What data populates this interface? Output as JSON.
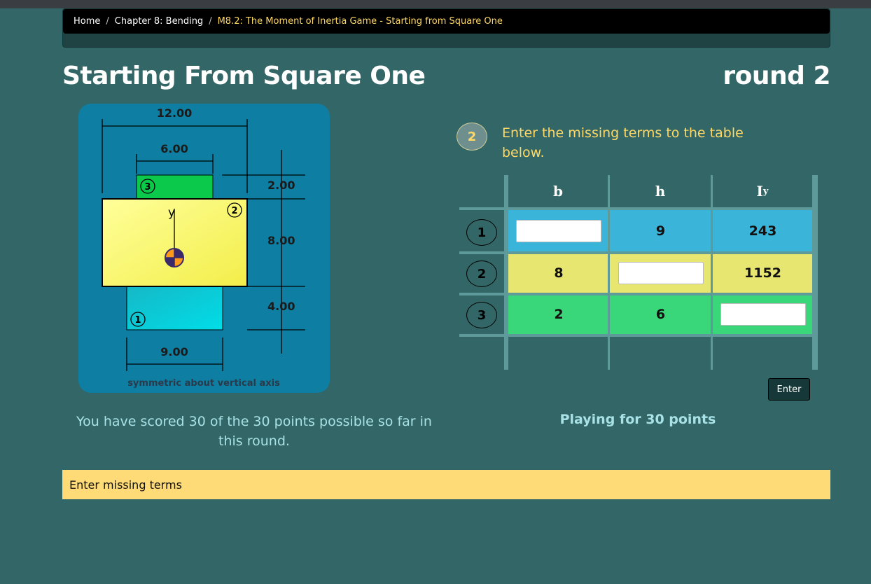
{
  "breadcrumb": {
    "items": [
      "Home",
      "Chapter 8: Bending"
    ],
    "current": "M8.2: The Moment of Inertia Game - Starting from Square One"
  },
  "page": {
    "title": "Starting From Square One",
    "round": "round 2"
  },
  "figure": {
    "dims": {
      "top_width": "12.00",
      "mid_width": "6.00",
      "bottom_width": "9.00",
      "h_top": "2.00",
      "h_mid": "8.00",
      "h_bot": "4.00"
    },
    "labels": {
      "part1": "1",
      "part2": "2",
      "part3": "3",
      "axis": "y"
    },
    "caption": "symmetric about vertical axis",
    "colors": {
      "background": "#0e7fa3",
      "part1": "#00c8d6",
      "part2": "#fbf56a",
      "part3": "#0bc94a",
      "centroid": "#ff9a1a"
    }
  },
  "step": {
    "number": "2",
    "instruction": "Enter the missing terms to the table below."
  },
  "table": {
    "headers": {
      "b": "b",
      "h": "h",
      "iy_main": "I",
      "iy_sub": "y"
    },
    "rows": [
      {
        "num": "1",
        "b": "",
        "h": "9",
        "iy": "243",
        "color": "#3ab4d8"
      },
      {
        "num": "2",
        "b": "8",
        "h": "",
        "iy": "1152",
        "color": "#e6e670"
      },
      {
        "num": "3",
        "b": "2",
        "h": "6",
        "iy": "",
        "color": "#3ad67a"
      }
    ]
  },
  "buttons": {
    "enter": "Enter"
  },
  "score": {
    "text": "You have scored 30 of the 30 points possible so far in this round."
  },
  "playing": {
    "text": "Playing for 30 points"
  },
  "message": {
    "text": "Enter missing terms"
  }
}
